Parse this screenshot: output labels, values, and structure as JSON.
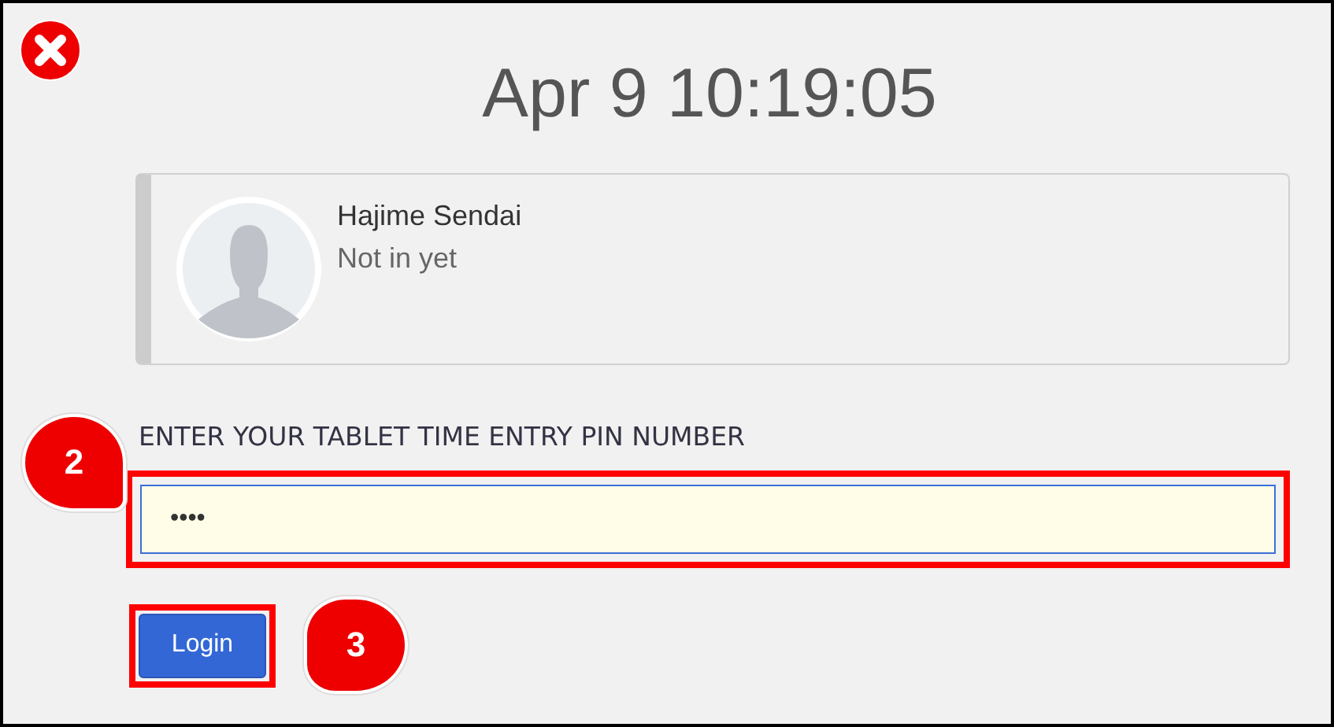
{
  "datetime": "Apr 9 10:19:05",
  "employee": {
    "name": "Hajime Sendai",
    "status": "Not in yet"
  },
  "pin_field": {
    "label": "ENTER YOUR TABLET TIME ENTRY PIN NUMBER",
    "value": "••••",
    "highlighted": true,
    "callout": "2"
  },
  "login_button": {
    "label": "Login",
    "highlighted": true,
    "callout": "3"
  }
}
